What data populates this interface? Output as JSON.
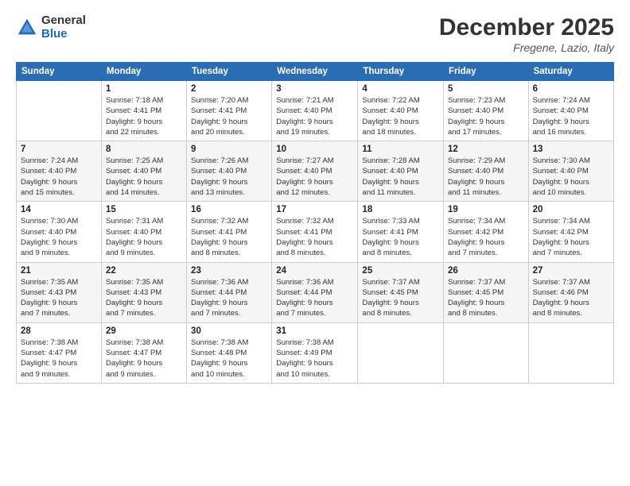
{
  "logo": {
    "general": "General",
    "blue": "Blue"
  },
  "title": "December 2025",
  "location": "Fregene, Lazio, Italy",
  "days_header": [
    "Sunday",
    "Monday",
    "Tuesday",
    "Wednesday",
    "Thursday",
    "Friday",
    "Saturday"
  ],
  "weeks": [
    [
      {
        "day": "",
        "info": ""
      },
      {
        "day": "1",
        "info": "Sunrise: 7:18 AM\nSunset: 4:41 PM\nDaylight: 9 hours\nand 22 minutes."
      },
      {
        "day": "2",
        "info": "Sunrise: 7:20 AM\nSunset: 4:41 PM\nDaylight: 9 hours\nand 20 minutes."
      },
      {
        "day": "3",
        "info": "Sunrise: 7:21 AM\nSunset: 4:40 PM\nDaylight: 9 hours\nand 19 minutes."
      },
      {
        "day": "4",
        "info": "Sunrise: 7:22 AM\nSunset: 4:40 PM\nDaylight: 9 hours\nand 18 minutes."
      },
      {
        "day": "5",
        "info": "Sunrise: 7:23 AM\nSunset: 4:40 PM\nDaylight: 9 hours\nand 17 minutes."
      },
      {
        "day": "6",
        "info": "Sunrise: 7:24 AM\nSunset: 4:40 PM\nDaylight: 9 hours\nand 16 minutes."
      }
    ],
    [
      {
        "day": "7",
        "info": "Sunrise: 7:24 AM\nSunset: 4:40 PM\nDaylight: 9 hours\nand 15 minutes."
      },
      {
        "day": "8",
        "info": "Sunrise: 7:25 AM\nSunset: 4:40 PM\nDaylight: 9 hours\nand 14 minutes."
      },
      {
        "day": "9",
        "info": "Sunrise: 7:26 AM\nSunset: 4:40 PM\nDaylight: 9 hours\nand 13 minutes."
      },
      {
        "day": "10",
        "info": "Sunrise: 7:27 AM\nSunset: 4:40 PM\nDaylight: 9 hours\nand 12 minutes."
      },
      {
        "day": "11",
        "info": "Sunrise: 7:28 AM\nSunset: 4:40 PM\nDaylight: 9 hours\nand 11 minutes."
      },
      {
        "day": "12",
        "info": "Sunrise: 7:29 AM\nSunset: 4:40 PM\nDaylight: 9 hours\nand 11 minutes."
      },
      {
        "day": "13",
        "info": "Sunrise: 7:30 AM\nSunset: 4:40 PM\nDaylight: 9 hours\nand 10 minutes."
      }
    ],
    [
      {
        "day": "14",
        "info": "Sunrise: 7:30 AM\nSunset: 4:40 PM\nDaylight: 9 hours\nand 9 minutes."
      },
      {
        "day": "15",
        "info": "Sunrise: 7:31 AM\nSunset: 4:40 PM\nDaylight: 9 hours\nand 9 minutes."
      },
      {
        "day": "16",
        "info": "Sunrise: 7:32 AM\nSunset: 4:41 PM\nDaylight: 9 hours\nand 8 minutes."
      },
      {
        "day": "17",
        "info": "Sunrise: 7:32 AM\nSunset: 4:41 PM\nDaylight: 9 hours\nand 8 minutes."
      },
      {
        "day": "18",
        "info": "Sunrise: 7:33 AM\nSunset: 4:41 PM\nDaylight: 9 hours\nand 8 minutes."
      },
      {
        "day": "19",
        "info": "Sunrise: 7:34 AM\nSunset: 4:42 PM\nDaylight: 9 hours\nand 7 minutes."
      },
      {
        "day": "20",
        "info": "Sunrise: 7:34 AM\nSunset: 4:42 PM\nDaylight: 9 hours\nand 7 minutes."
      }
    ],
    [
      {
        "day": "21",
        "info": "Sunrise: 7:35 AM\nSunset: 4:43 PM\nDaylight: 9 hours\nand 7 minutes."
      },
      {
        "day": "22",
        "info": "Sunrise: 7:35 AM\nSunset: 4:43 PM\nDaylight: 9 hours\nand 7 minutes."
      },
      {
        "day": "23",
        "info": "Sunrise: 7:36 AM\nSunset: 4:44 PM\nDaylight: 9 hours\nand 7 minutes."
      },
      {
        "day": "24",
        "info": "Sunrise: 7:36 AM\nSunset: 4:44 PM\nDaylight: 9 hours\nand 7 minutes."
      },
      {
        "day": "25",
        "info": "Sunrise: 7:37 AM\nSunset: 4:45 PM\nDaylight: 9 hours\nand 8 minutes."
      },
      {
        "day": "26",
        "info": "Sunrise: 7:37 AM\nSunset: 4:45 PM\nDaylight: 9 hours\nand 8 minutes."
      },
      {
        "day": "27",
        "info": "Sunrise: 7:37 AM\nSunset: 4:46 PM\nDaylight: 9 hours\nand 8 minutes."
      }
    ],
    [
      {
        "day": "28",
        "info": "Sunrise: 7:38 AM\nSunset: 4:47 PM\nDaylight: 9 hours\nand 9 minutes."
      },
      {
        "day": "29",
        "info": "Sunrise: 7:38 AM\nSunset: 4:47 PM\nDaylight: 9 hours\nand 9 minutes."
      },
      {
        "day": "30",
        "info": "Sunrise: 7:38 AM\nSunset: 4:48 PM\nDaylight: 9 hours\nand 10 minutes."
      },
      {
        "day": "31",
        "info": "Sunrise: 7:38 AM\nSunset: 4:49 PM\nDaylight: 9 hours\nand 10 minutes."
      },
      {
        "day": "",
        "info": ""
      },
      {
        "day": "",
        "info": ""
      },
      {
        "day": "",
        "info": ""
      }
    ]
  ]
}
